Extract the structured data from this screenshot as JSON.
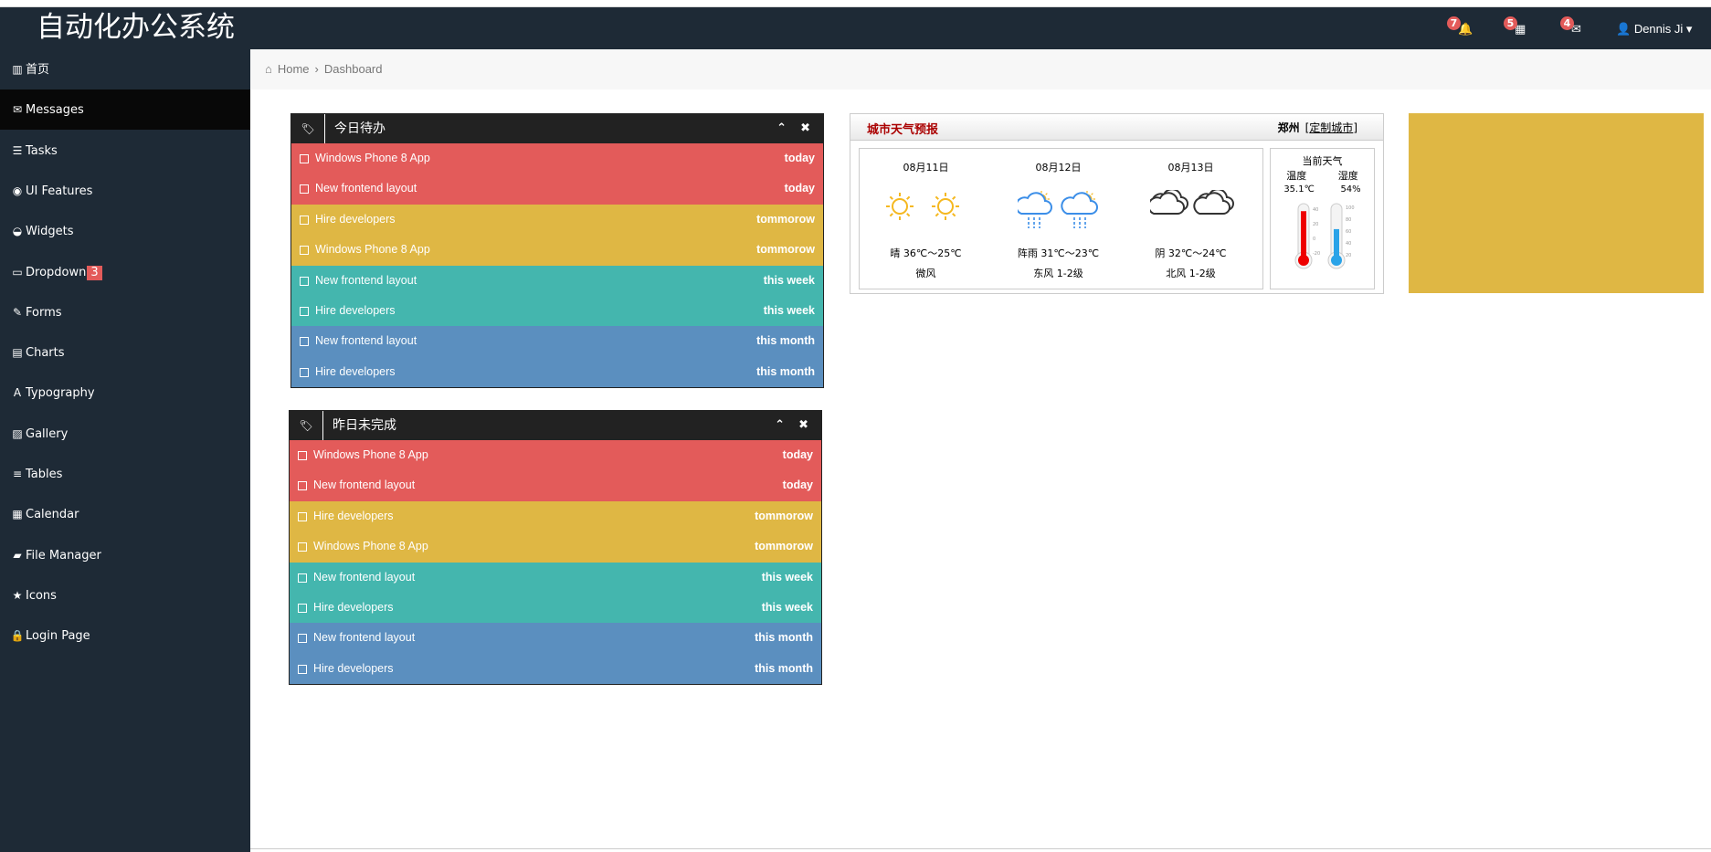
{
  "header": {
    "title": "自动化办公系统",
    "notifications": [
      {
        "icon": "bell-icon",
        "glyph": "🔔",
        "count": "7"
      },
      {
        "icon": "calendar-icon",
        "glyph": "▦",
        "count": "5"
      },
      {
        "icon": "envelope-icon",
        "glyph": "✉",
        "count": "4"
      }
    ],
    "user": "Dennis Ji"
  },
  "sidebar": {
    "items": [
      {
        "icon": "bar-chart-icon",
        "glyph": "▥",
        "label": "首页"
      },
      {
        "icon": "envelope-icon",
        "glyph": "✉",
        "label": "Messages",
        "active": true
      },
      {
        "icon": "tasks-icon",
        "glyph": "☰",
        "label": "Tasks"
      },
      {
        "icon": "eye-icon",
        "glyph": "◉",
        "label": "UI Features"
      },
      {
        "icon": "dashboard-icon",
        "glyph": "◒",
        "label": "Widgets"
      },
      {
        "icon": "folder-icon",
        "glyph": "▭",
        "label": "Dropdown",
        "badge": "3"
      },
      {
        "icon": "edit-icon",
        "glyph": "✎",
        "label": "Forms"
      },
      {
        "icon": "list-alt-icon",
        "glyph": "▤",
        "label": "Charts"
      },
      {
        "icon": "font-icon",
        "glyph": "A",
        "label": "Typography"
      },
      {
        "icon": "picture-icon",
        "glyph": "▨",
        "label": "Gallery"
      },
      {
        "icon": "table-icon",
        "glyph": "≡",
        "label": "Tables"
      },
      {
        "icon": "calendar-icon",
        "glyph": "▦",
        "label": "Calendar"
      },
      {
        "icon": "folder-open-icon",
        "glyph": "▰",
        "label": "File Manager"
      },
      {
        "icon": "star-icon",
        "glyph": "★",
        "label": "Icons"
      },
      {
        "icon": "lock-icon",
        "glyph": "🔒",
        "label": "Login Page"
      }
    ]
  },
  "breadcrumb": {
    "home": "Home",
    "current": "Dashboard"
  },
  "colors": {
    "today": "#e35b5a",
    "tommorow": "#dfb744",
    "this week": "#44b6ae",
    "this month": "#5b8fbf"
  },
  "panels": [
    {
      "title": "今日待办",
      "rows": [
        {
          "text": "Windows Phone 8 App",
          "when": "today"
        },
        {
          "text": "New frontend layout",
          "when": "today"
        },
        {
          "text": "Hire developers",
          "when": "tommorow"
        },
        {
          "text": "Windows Phone 8 App",
          "when": "tommorow"
        },
        {
          "text": "New frontend layout",
          "when": "this week"
        },
        {
          "text": "Hire developers",
          "when": "this week"
        },
        {
          "text": "New frontend layout",
          "when": "this month"
        },
        {
          "text": "Hire developers",
          "when": "this month"
        }
      ]
    },
    {
      "title": "昨日未完成",
      "rows": [
        {
          "text": "Windows Phone 8 App",
          "when": "today"
        },
        {
          "text": "New frontend layout",
          "when": "today"
        },
        {
          "text": "Hire developers",
          "when": "tommorow"
        },
        {
          "text": "Windows Phone 8 App",
          "when": "tommorow"
        },
        {
          "text": "New frontend layout",
          "when": "this week"
        },
        {
          "text": "Hire developers",
          "when": "this week"
        },
        {
          "text": "New frontend layout",
          "when": "this month"
        },
        {
          "text": "Hire developers",
          "when": "this month"
        }
      ]
    }
  ],
  "weather": {
    "title": "城市天气预报",
    "city": "郑州",
    "customize": "定制城市",
    "days": [
      {
        "date": "08月11日",
        "icon": "sun-icon",
        "temp": "晴 36℃～25℃",
        "wind": "微风"
      },
      {
        "date": "08月12日",
        "icon": "rain-icon",
        "temp": "阵雨 31℃～23℃",
        "wind": "东风 1-2级"
      },
      {
        "date": "08月13日",
        "icon": "cloud-icon",
        "temp": "阴 32℃～24℃",
        "wind": "北风 1-2级"
      }
    ],
    "current": {
      "label": "当前天气",
      "temp_label": "温度",
      "humidity_label": "湿度",
      "temp": "35.1℃",
      "humidity": "54%",
      "temp_scale": [
        "40",
        "20",
        "0",
        "-20"
      ],
      "humidity_scale": [
        "100",
        "80",
        "60",
        "40",
        "20"
      ]
    }
  }
}
